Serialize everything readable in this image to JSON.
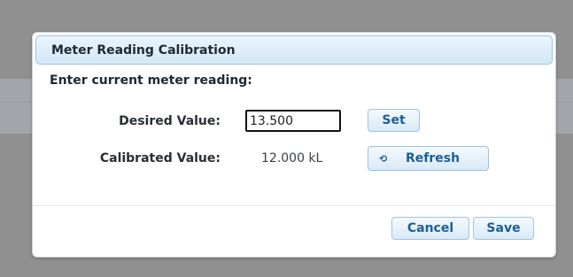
{
  "dialog": {
    "title": "Meter Reading Calibration",
    "prompt": "Enter current meter reading:",
    "desired_label": "Desired Value:",
    "desired_value": "13.500",
    "set_label": "Set",
    "calibrated_label": "Calibrated Value:",
    "calibrated_value": "12.000 kL",
    "refresh_label": "Refresh",
    "refresh_icon": "refresh-icon",
    "cancel_label": "Cancel",
    "save_label": "Save"
  },
  "colors": {
    "backdrop": "#909090",
    "title_bar": "#d3e7f6",
    "button_text": "#1d5f96",
    "button_border": "#9fc3e0"
  }
}
